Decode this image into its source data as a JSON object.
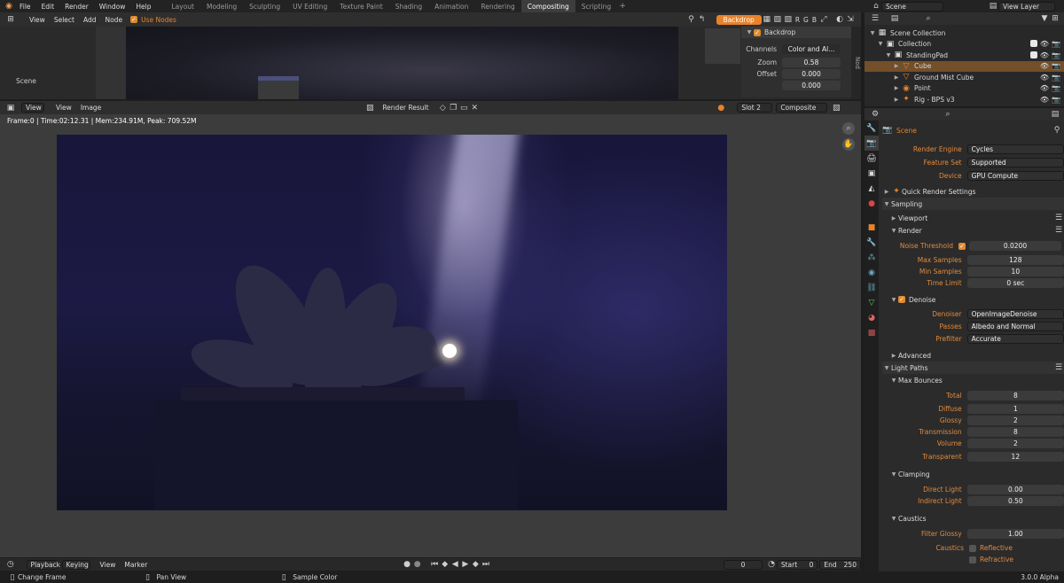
{
  "topbar": {
    "menus": [
      "File",
      "Edit",
      "Render",
      "Window",
      "Help"
    ],
    "workspaces": [
      "Layout",
      "Modeling",
      "Sculpting",
      "UV Editing",
      "Texture Paint",
      "Shading",
      "Animation",
      "Rendering",
      "Compositing",
      "Scripting"
    ],
    "active_workspace": "Compositing",
    "scene_label": "Scene",
    "view_layer_label": "View Layer"
  },
  "node_editor": {
    "menus": [
      "View",
      "Select",
      "Add",
      "Node"
    ],
    "use_nodes_label": "Use Nodes",
    "backdrop_button": "Backdrop",
    "channel_letters": [
      "R",
      "G",
      "B"
    ],
    "scene_label": "Scene",
    "panel": {
      "title": "Backdrop",
      "channels_label": "Channels",
      "channels_value": "Color and Al...",
      "zoom_label": "Zoom",
      "zoom_value": "0.58",
      "offset_label": "Offset",
      "offset_x": "0.000",
      "offset_y": "0.000",
      "side_tab": "Nod"
    }
  },
  "image_editor": {
    "menus": [
      "View",
      "Image"
    ],
    "view_mode": "View",
    "image_name": "Render Result",
    "slot": "Slot 2",
    "layer": "Composite",
    "stats": "Frame:0 | Time:02:12.31 | Mem:234.91M, Peak: 709.52M"
  },
  "timeline": {
    "playback": "Playback",
    "keying": "Keying",
    "view": "View",
    "marker": "Marker",
    "current_frame": "0",
    "start_label": "Start",
    "start": "0",
    "end_label": "End",
    "end": "250"
  },
  "statusbar": {
    "items": [
      "Change Frame",
      "Pan View",
      "Sample Color"
    ],
    "version": "3.0.0 Alpha"
  },
  "outliner": {
    "rows": [
      {
        "label": "Scene Collection",
        "indent": 0
      },
      {
        "label": "Collection",
        "indent": 1
      },
      {
        "label": "StandingPad",
        "indent": 2
      },
      {
        "label": "Cube",
        "indent": 3,
        "selected": true
      },
      {
        "label": "Ground Mist Cube",
        "indent": 3
      },
      {
        "label": "Point",
        "indent": 3
      },
      {
        "label": "Rig - BPS v3",
        "indent": 3
      }
    ]
  },
  "properties": {
    "context": "Scene",
    "render_engine_label": "Render Engine",
    "render_engine": "Cycles",
    "feature_set_label": "Feature Set",
    "feature_set": "Supported",
    "device_label": "Device",
    "device": "GPU Compute",
    "quick_render": "Quick Render Settings",
    "sampling": "Sampling",
    "viewport": "Viewport",
    "render": "Render",
    "noise_threshold_label": "Noise Threshold",
    "noise_threshold": "0.0200",
    "max_samples_label": "Max Samples",
    "max_samples": "128",
    "min_samples_label": "Min Samples",
    "min_samples": "10",
    "time_limit_label": "Time Limit",
    "time_limit": "0 sec",
    "denoise": "Denoise",
    "denoiser_label": "Denoiser",
    "denoiser": "OpenImageDenoise",
    "passes_label": "Passes",
    "passes": "Albedo and Normal",
    "prefilter_label": "Prefilter",
    "prefilter": "Accurate",
    "advanced": "Advanced",
    "light_paths": "Light Paths",
    "max_bounces": "Max Bounces",
    "total_label": "Total",
    "total": "8",
    "diffuse_label": "Diffuse",
    "diffuse": "1",
    "glossy_label": "Glossy",
    "glossy": "2",
    "transmission_label": "Transmission",
    "transmission": "8",
    "volume_label": "Volume",
    "volume": "2",
    "transparent_label": "Transparent",
    "transparent": "12",
    "clamping": "Clamping",
    "direct_light_label": "Direct Light",
    "direct_light": "0.00",
    "indirect_light_label": "Indirect Light",
    "indirect_light": "0.50",
    "caustics": "Caustics",
    "filter_glossy_label": "Filter Glossy",
    "filter_glossy": "1.00",
    "caustics_label": "Caustics",
    "reflective": "Reflective",
    "refractive": "Refractive"
  },
  "colors": {
    "accent": "#e8822b",
    "selected": "#734f2a",
    "active_tab": "#3d3d3d"
  }
}
